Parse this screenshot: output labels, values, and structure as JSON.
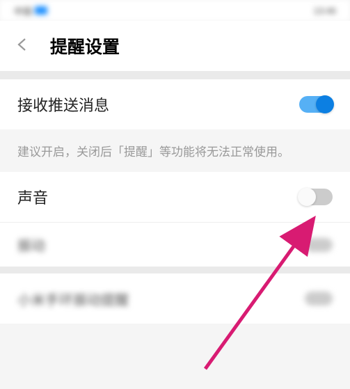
{
  "statusBar": {
    "leftText": "中国",
    "rightText": "13:46"
  },
  "header": {
    "title": "提醒设置"
  },
  "settings": {
    "pushNotifications": {
      "label": "接收推送消息",
      "enabled": true,
      "hint": "建议开启，关闭后「提醒」等功能将无法正常使用。"
    },
    "sound": {
      "label": "声音",
      "enabled": false
    },
    "vibration": {
      "label": "振动"
    },
    "blurred1": {
      "label": "小米手环振动提醒"
    }
  },
  "colors": {
    "toggleOn": "#0c7fe2",
    "toggleTrackOn": "#56b0f5",
    "arrow": "#d81b72"
  }
}
